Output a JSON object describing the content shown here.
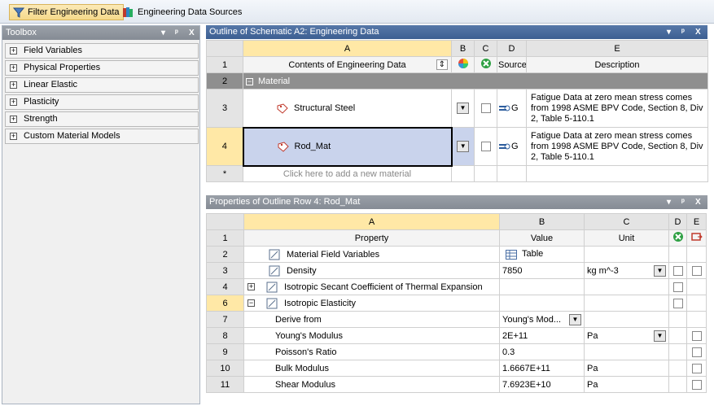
{
  "toolbar": {
    "filter_label": "Filter Engineering Data",
    "sources_label": "Engineering Data Sources"
  },
  "toolbox": {
    "title": "Toolbox",
    "items": [
      {
        "label": "Field Variables"
      },
      {
        "label": "Physical Properties"
      },
      {
        "label": "Linear Elastic"
      },
      {
        "label": "Plasticity"
      },
      {
        "label": "Strength"
      },
      {
        "label": "Custom Material Models"
      }
    ]
  },
  "outline": {
    "title": "Outline of Schematic A2: Engineering Data",
    "col_letters": [
      "A",
      "B",
      "C",
      "D",
      "E"
    ],
    "row_numbers": [
      "1",
      "2",
      "3",
      "4",
      "*"
    ],
    "header": {
      "contents": "Contents of Engineering Data",
      "source": "Source",
      "description": "Description"
    },
    "section": "Material",
    "materials": [
      {
        "name": "Structural Steel",
        "source_letter": "G",
        "description": "Fatigue Data at zero mean stress comes from 1998 ASME BPV Code, Section 8, Div 2, Table 5-110.1"
      },
      {
        "name": "Rod_Mat",
        "source_letter": "G",
        "description": "Fatigue Data at zero mean stress comes from 1998 ASME BPV Code, Section 8, Div 2, Table 5-110.1"
      }
    ],
    "add_placeholder": "Click here to add a new material"
  },
  "properties": {
    "title": "Properties of Outline Row 4: Rod_Mat",
    "col_letters": [
      "A",
      "B",
      "C",
      "D",
      "E"
    ],
    "header": {
      "property": "Property",
      "value": "Value",
      "unit": "Unit"
    },
    "rows": [
      {
        "num": "2",
        "name": "Material Field Variables",
        "value": "Table",
        "unit": ""
      },
      {
        "num": "3",
        "name": "Density",
        "value": "7850",
        "unit": "kg m^-3"
      },
      {
        "num": "4",
        "name": "Isotropic Secant Coefficient of Thermal Expansion",
        "value": "",
        "unit": ""
      },
      {
        "num": "6",
        "name": "Isotropic Elasticity",
        "value": "",
        "unit": ""
      },
      {
        "num": "7",
        "name": "Derive from",
        "value": "Young's Mod...",
        "unit": ""
      },
      {
        "num": "8",
        "name": "Young's Modulus",
        "value": "2E+11",
        "unit": "Pa"
      },
      {
        "num": "9",
        "name": "Poisson's Ratio",
        "value": "0.3",
        "unit": ""
      },
      {
        "num": "10",
        "name": "Bulk Modulus",
        "value": "1.6667E+11",
        "unit": "Pa"
      },
      {
        "num": "11",
        "name": "Shear Modulus",
        "value": "7.6923E+10",
        "unit": "Pa"
      }
    ]
  },
  "header_controls": {
    "pin": "▾",
    "dock": "ᵖ",
    "close": "X"
  },
  "colors": {
    "header_blue": "#3c5f92",
    "selection": "#ffe8a6",
    "selected_row": "#c9d3ec"
  }
}
